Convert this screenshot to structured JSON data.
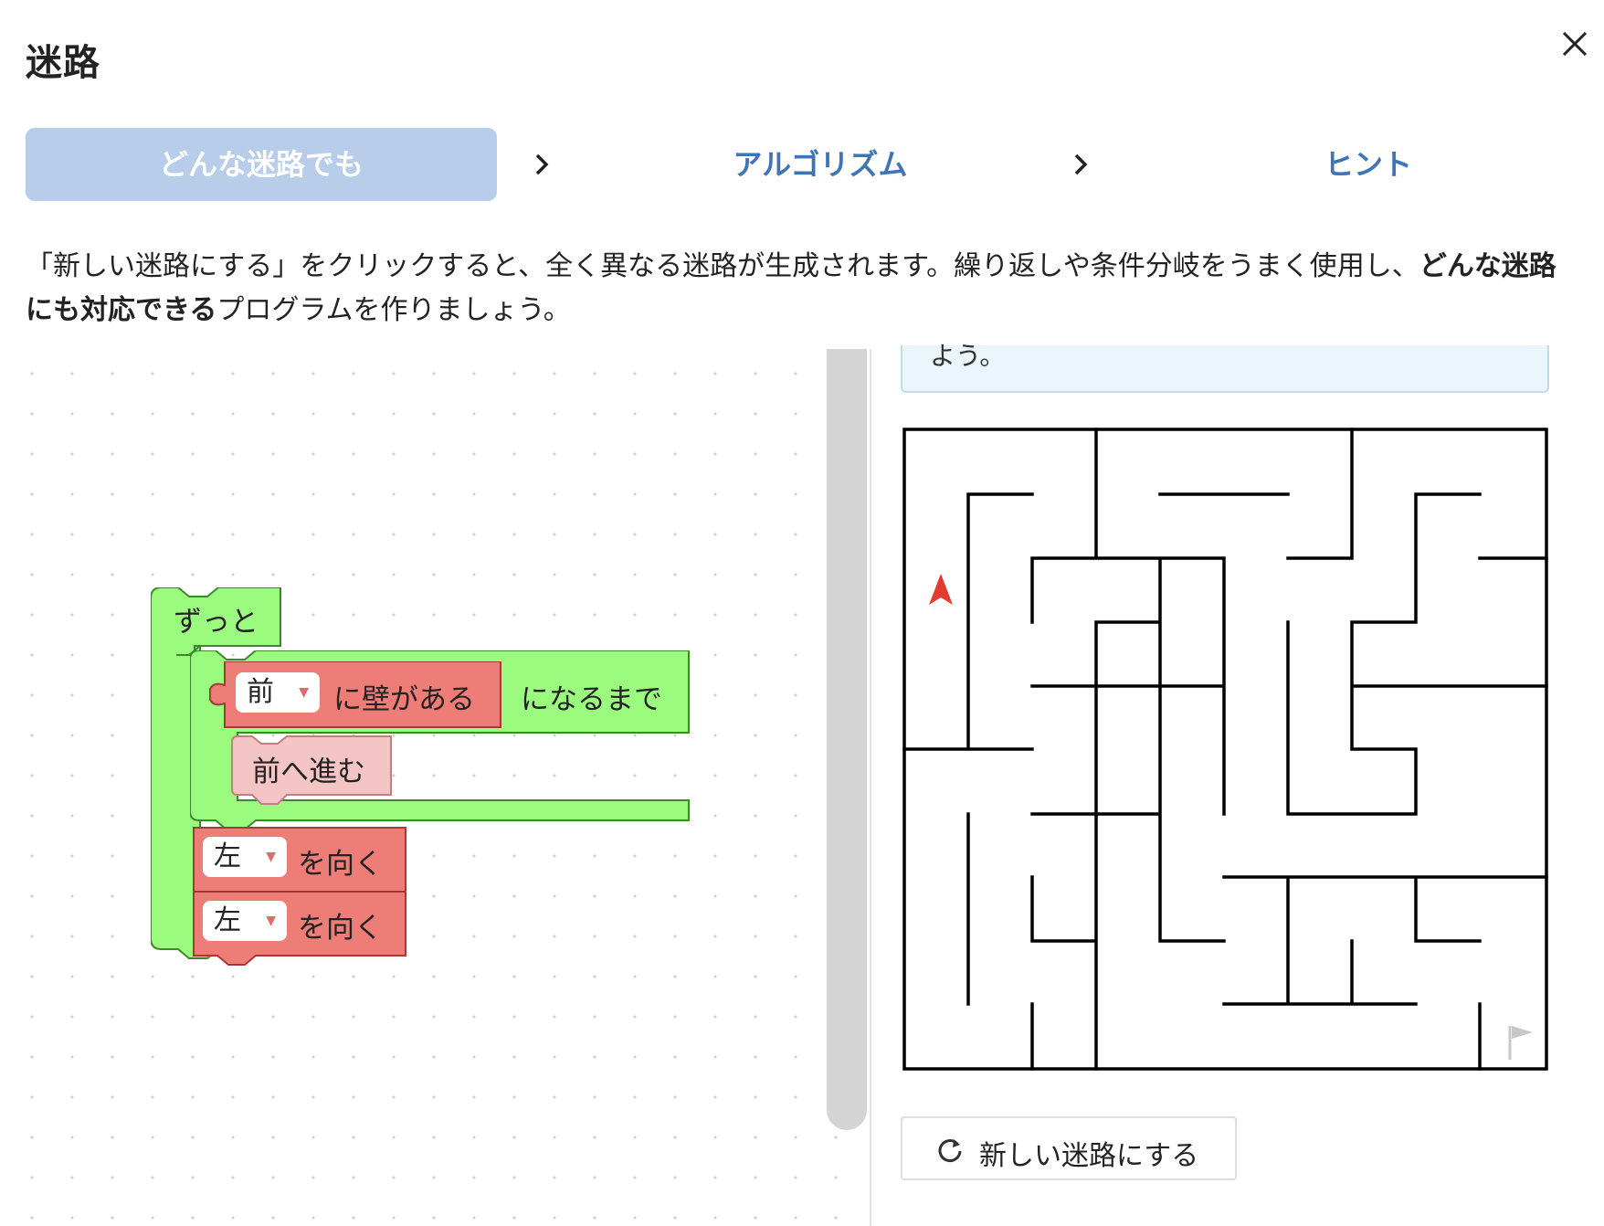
{
  "header": {
    "title": "迷路",
    "close_icon": "close-icon"
  },
  "steps": [
    {
      "label": "どんな迷路でも",
      "active": true
    },
    {
      "label": "アルゴリズム",
      "active": false
    },
    {
      "label": "ヒント",
      "active": false
    }
  ],
  "description": {
    "part1": "「新しい迷路にする」をクリックすると、全く異なる迷路が生成されます。繰り返しや条件分岐をうまく使用し、",
    "bold": "どんな迷路にも対応できる",
    "part2": "プログラムを作りましょう。"
  },
  "blocks": {
    "forever_label": "ずっと",
    "repeat_until": {
      "direction": "前",
      "condition": "に壁がある",
      "suffix": "になるまで"
    },
    "move_forward": "前へ進む",
    "turn1": {
      "direction": "左",
      "suffix": "を向く"
    },
    "turn2": {
      "direction": "左",
      "suffix": "を向く"
    }
  },
  "hint_text": "よう。",
  "maze": {
    "player": "red-arrow-icon",
    "goal": "flag-icon"
  },
  "new_maze_button": {
    "label": "新しい迷路にする",
    "icon": "refresh-icon"
  },
  "colors": {
    "accent": "#3f74b7",
    "active_tab": "#b7cdea",
    "control_block": "#9bfb7f",
    "sensor_block": "#ee7c77",
    "action_block": "#f5c4c4",
    "player": "#e53b2e"
  }
}
